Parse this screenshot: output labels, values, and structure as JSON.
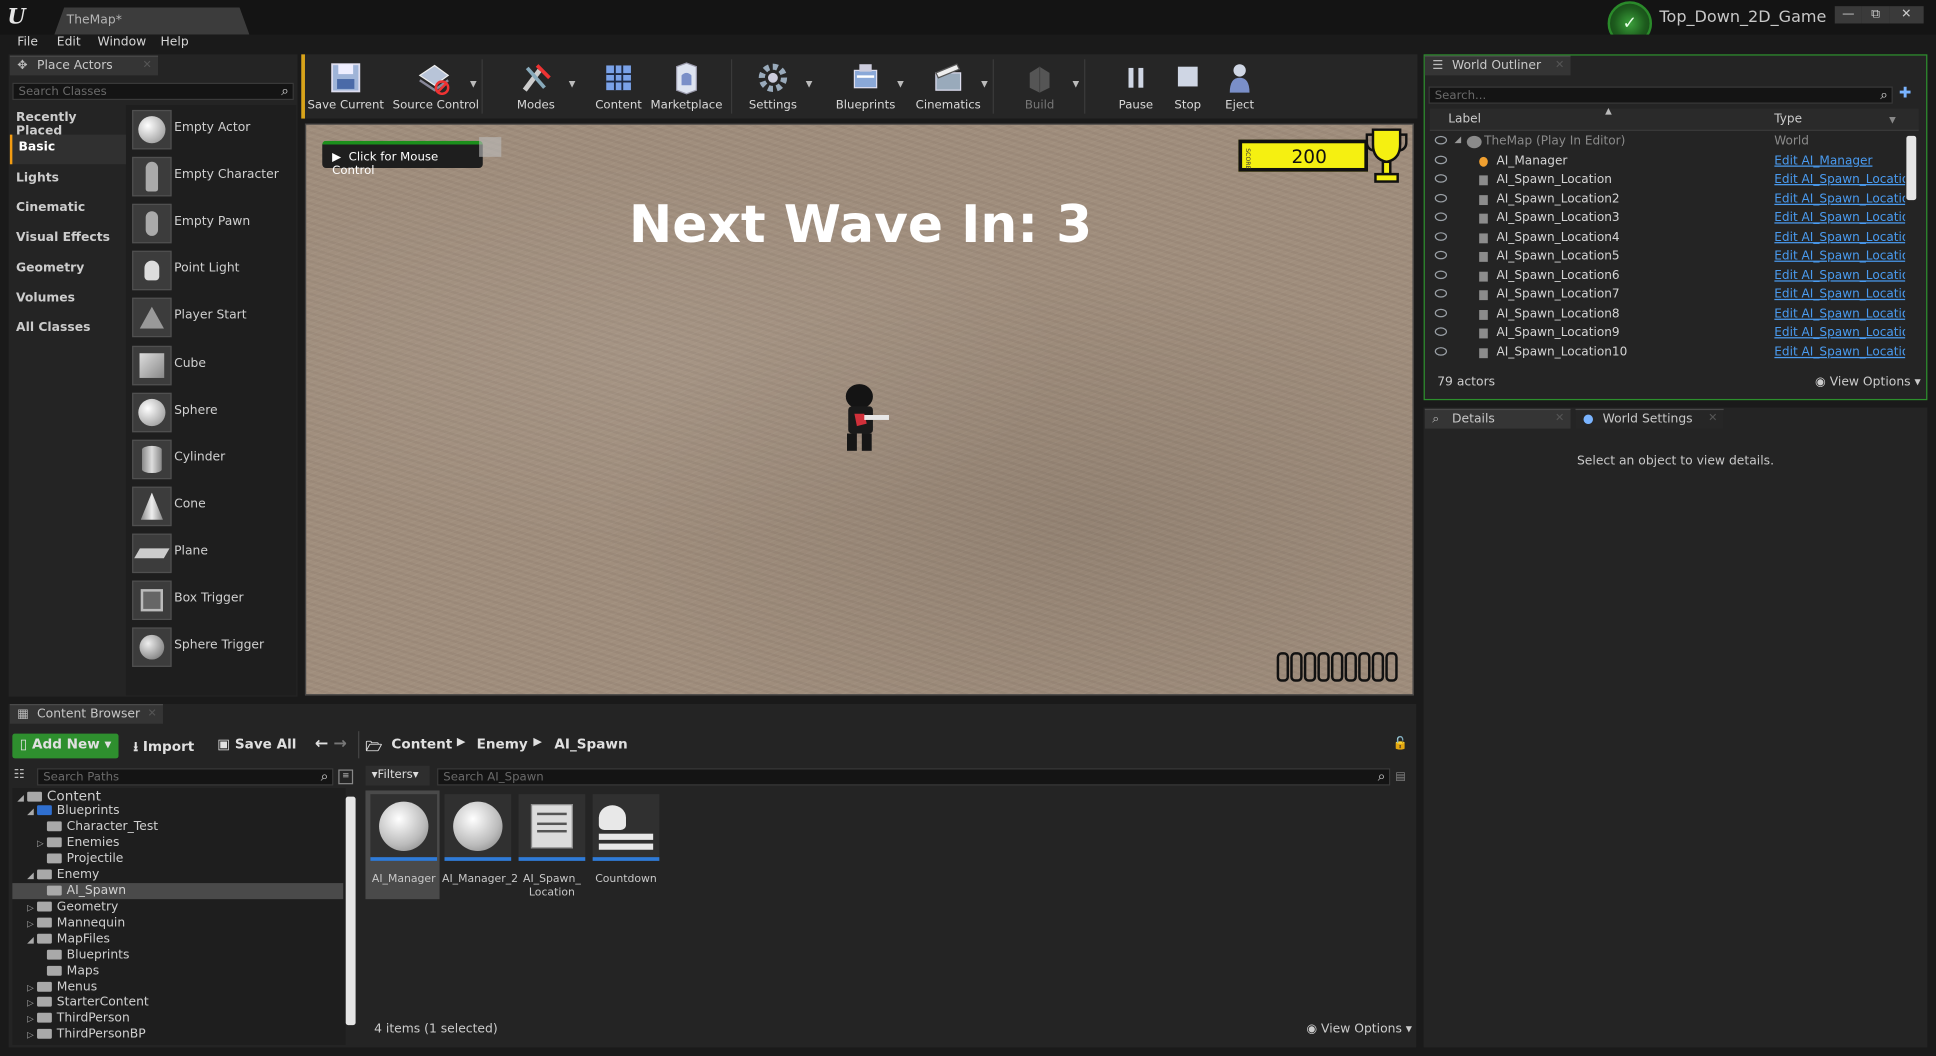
{
  "window": {
    "doc_tab": "TheMap*",
    "project_name": "Top_Down_2D_Game",
    "min": "—",
    "restore": "⧉",
    "close": "✕"
  },
  "menu": [
    "File",
    "Edit",
    "Window",
    "Help"
  ],
  "place_actors": {
    "tab": "Place Actors",
    "search_placeholder": "Search Classes",
    "categories": [
      "Recently Placed",
      "Basic",
      "Lights",
      "Cinematic",
      "Visual Effects",
      "Geometry",
      "Volumes",
      "All Classes"
    ],
    "selected_category": "Basic",
    "actors": [
      "Empty Actor",
      "Empty Character",
      "Empty Pawn",
      "Point Light",
      "Player Start",
      "Cube",
      "Sphere",
      "Cylinder",
      "Cone",
      "Plane",
      "Box Trigger",
      "Sphere Trigger"
    ]
  },
  "toolbar": {
    "buttons": [
      "Save Current",
      "Source Control",
      "Modes",
      "Content",
      "Marketplace",
      "Settings",
      "Blueprints",
      "Cinematics",
      "Build",
      "Pause",
      "Stop",
      "Eject"
    ]
  },
  "viewport": {
    "mouse_control": "Click for Mouse Control",
    "wave_text": "Next Wave In: 3",
    "score": "200",
    "score_side": "SCORE"
  },
  "outliner": {
    "tab": "World Outliner",
    "search_placeholder": "Search...",
    "col_label": "Label",
    "col_type": "Type",
    "root": {
      "name": "TheMap (Play In Editor)",
      "type": "World"
    },
    "rows": [
      {
        "name": "AI_Manager",
        "type": "Edit AI_Manager"
      },
      {
        "name": "AI_Spawn_Location",
        "type": "Edit AI_Spawn_Locatio"
      },
      {
        "name": "AI_Spawn_Location2",
        "type": "Edit AI_Spawn_Locatio"
      },
      {
        "name": "AI_Spawn_Location3",
        "type": "Edit AI_Spawn_Locatio"
      },
      {
        "name": "AI_Spawn_Location4",
        "type": "Edit AI_Spawn_Locatio"
      },
      {
        "name": "AI_Spawn_Location5",
        "type": "Edit AI_Spawn_Locatio"
      },
      {
        "name": "AI_Spawn_Location6",
        "type": "Edit AI_Spawn_Locatio"
      },
      {
        "name": "AI_Spawn_Location7",
        "type": "Edit AI_Spawn_Locatio"
      },
      {
        "name": "AI_Spawn_Location8",
        "type": "Edit AI_Spawn_Locatio"
      },
      {
        "name": "AI_Spawn_Location9",
        "type": "Edit AI_Spawn_Locatio"
      },
      {
        "name": "AI_Spawn_Location10",
        "type": "Edit AI_Spawn_Locatio"
      }
    ],
    "actor_count": "79 actors",
    "view_options": "View Options"
  },
  "details": {
    "tab_details": "Details",
    "tab_world": "World Settings",
    "empty_msg": "Select an object to view details."
  },
  "content_browser": {
    "tab": "Content Browser",
    "add_new": "Add New",
    "import": "Import",
    "save_all": "Save All",
    "path": [
      "Content",
      "Enemy",
      "AI_Spawn"
    ],
    "search_paths": "Search Paths",
    "filters": "Filters",
    "search_assets": "Search AI_Spawn",
    "tree": [
      {
        "label": "Content",
        "depth": 0,
        "exp": "open"
      },
      {
        "label": "Blueprints",
        "depth": 1,
        "exp": "open"
      },
      {
        "label": "Character_Test",
        "depth": 2,
        "exp": ""
      },
      {
        "label": "Enemies",
        "depth": 2,
        "exp": "closed"
      },
      {
        "label": "Projectile",
        "depth": 2,
        "exp": ""
      },
      {
        "label": "Enemy",
        "depth": 1,
        "exp": "open"
      },
      {
        "label": "AI_Spawn",
        "depth": 2,
        "exp": ""
      },
      {
        "label": "Geometry",
        "depth": 1,
        "exp": "closed"
      },
      {
        "label": "Mannequin",
        "depth": 1,
        "exp": "closed"
      },
      {
        "label": "MapFiles",
        "depth": 1,
        "exp": "open"
      },
      {
        "label": "Blueprints",
        "depth": 2,
        "exp": ""
      },
      {
        "label": "Maps",
        "depth": 2,
        "exp": ""
      },
      {
        "label": "Menus",
        "depth": 1,
        "exp": "closed"
      },
      {
        "label": "StarterContent",
        "depth": 1,
        "exp": "closed"
      },
      {
        "label": "ThirdPerson",
        "depth": 1,
        "exp": "closed"
      },
      {
        "label": "ThirdPersonBP",
        "depth": 1,
        "exp": "closed"
      }
    ],
    "assets": [
      "AI_Manager",
      "AI_Manager_2",
      "AI_Spawn_\nLocation",
      "Countdown"
    ],
    "status": "4 items (1 selected)",
    "view_options": "View Options"
  }
}
